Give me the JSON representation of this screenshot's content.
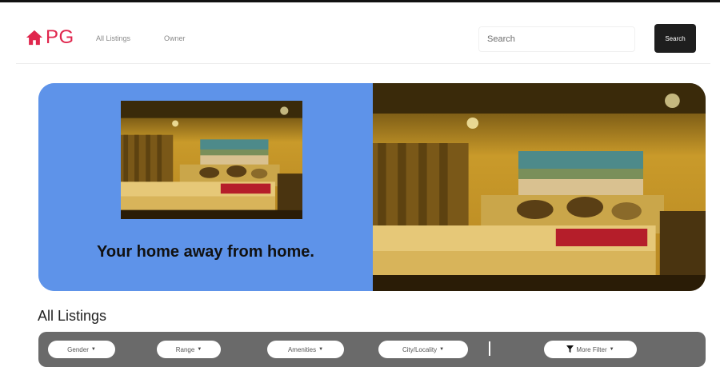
{
  "navbar": {
    "brand": "PG",
    "links": [
      "All Listings",
      "Owner"
    ],
    "search_placeholder": "Search",
    "search_button": "Search"
  },
  "hero": {
    "tagline": "Your home away from home."
  },
  "listings": {
    "heading": "All Listings"
  },
  "filters": {
    "items": [
      "Gender",
      "Range",
      "Amenities",
      "City/Locality",
      "More Filter"
    ]
  },
  "icons": {
    "brand": "home-icon",
    "caret": "caret-down-icon",
    "more_filter": "funnel-icon"
  },
  "colors": {
    "brand": "#e0264d",
    "hero_blue": "#5e93e9",
    "filter_bar": "#6a6a6a",
    "search_button": "#1e1e1e"
  }
}
